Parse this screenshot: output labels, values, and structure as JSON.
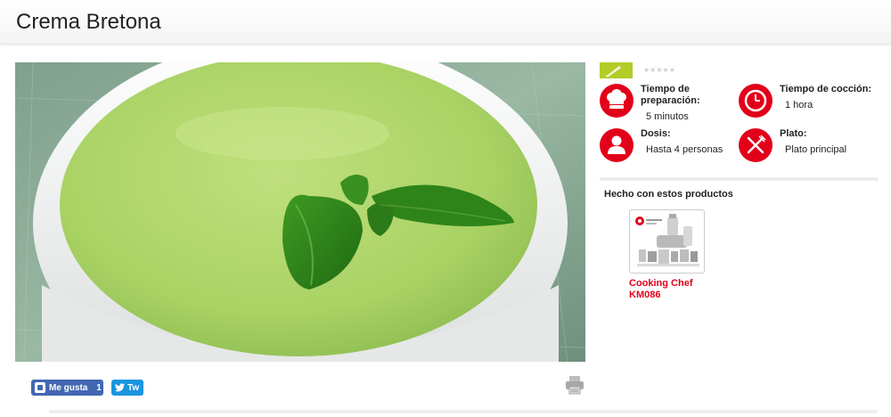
{
  "header": {
    "title": "Crema Bretona"
  },
  "social": {
    "like_label": "Me gusta",
    "like_count": "1",
    "tweet_label": "Tw"
  },
  "rating": {
    "stars": "★★★★★"
  },
  "info": {
    "prep": {
      "label": "Tiempo de preparación:",
      "value": "5 minutos"
    },
    "cook": {
      "label": "Tiempo de cocción:",
      "value": "1 hora"
    },
    "dose": {
      "label": "Dosis:",
      "value": "Hasta 4 personas"
    },
    "dish": {
      "label": "Plato:",
      "value": "Plato principal"
    }
  },
  "products": {
    "title": "Hecho con estos productos",
    "items": [
      {
        "name": "Cooking Chef KM086"
      }
    ]
  },
  "colors": {
    "accent": "#e2001a",
    "difficulty": "#b4cc28",
    "facebook": "#4267b2",
    "twitter": "#1b95e0"
  }
}
